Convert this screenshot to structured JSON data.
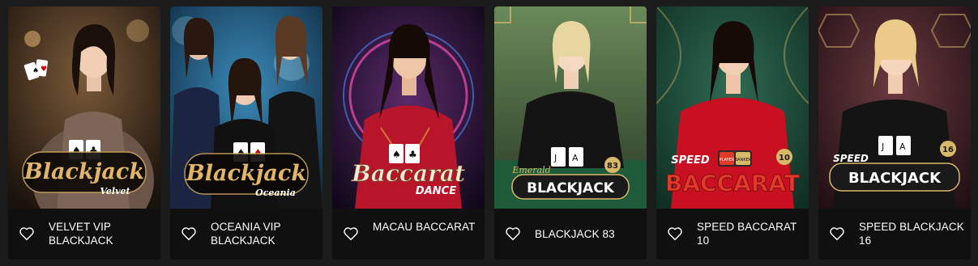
{
  "games": [
    {
      "title": "VELVET VIP BLACKJACK",
      "logo": [
        "Blackjack",
        "Velvet"
      ],
      "accent": "#c9a25a",
      "bg": "#3a2a1d"
    },
    {
      "title": "OCEANIA VIP BLACKJACK",
      "logo": [
        "Blackjack",
        "Oceania"
      ],
      "accent": "#c9a25a",
      "bg": "#123a5a"
    },
    {
      "title": "MACAU BACCARAT",
      "logo": [
        "Baccarat",
        "DANCE"
      ],
      "accent": "#e8e0d0",
      "bg": "#2a1640"
    },
    {
      "title": "BLACKJACK 83",
      "logo": [
        "Emerald",
        "BLACKJACK",
        "83"
      ],
      "accent": "#d9b86a",
      "bg": "#2f4a2c"
    },
    {
      "title": "SPEED BACCARAT 10",
      "logo": [
        "SPEED",
        "BACCARAT",
        "10",
        "PLAYER",
        "BANKER"
      ],
      "accent": "#e23a2a",
      "bg": "#1f4a3a"
    },
    {
      "title": "SPEED BLACKJACK 16",
      "logo": [
        "SPEED",
        "BLACKJACK",
        "16"
      ],
      "accent": "#d9b86a",
      "bg": "#3a1e24"
    }
  ],
  "icons": {
    "favorite": "heart-outline-icon"
  },
  "colors": {
    "page_bg": "#1b1b1b",
    "caption_bg": "#101010",
    "text": "#ffffff"
  }
}
